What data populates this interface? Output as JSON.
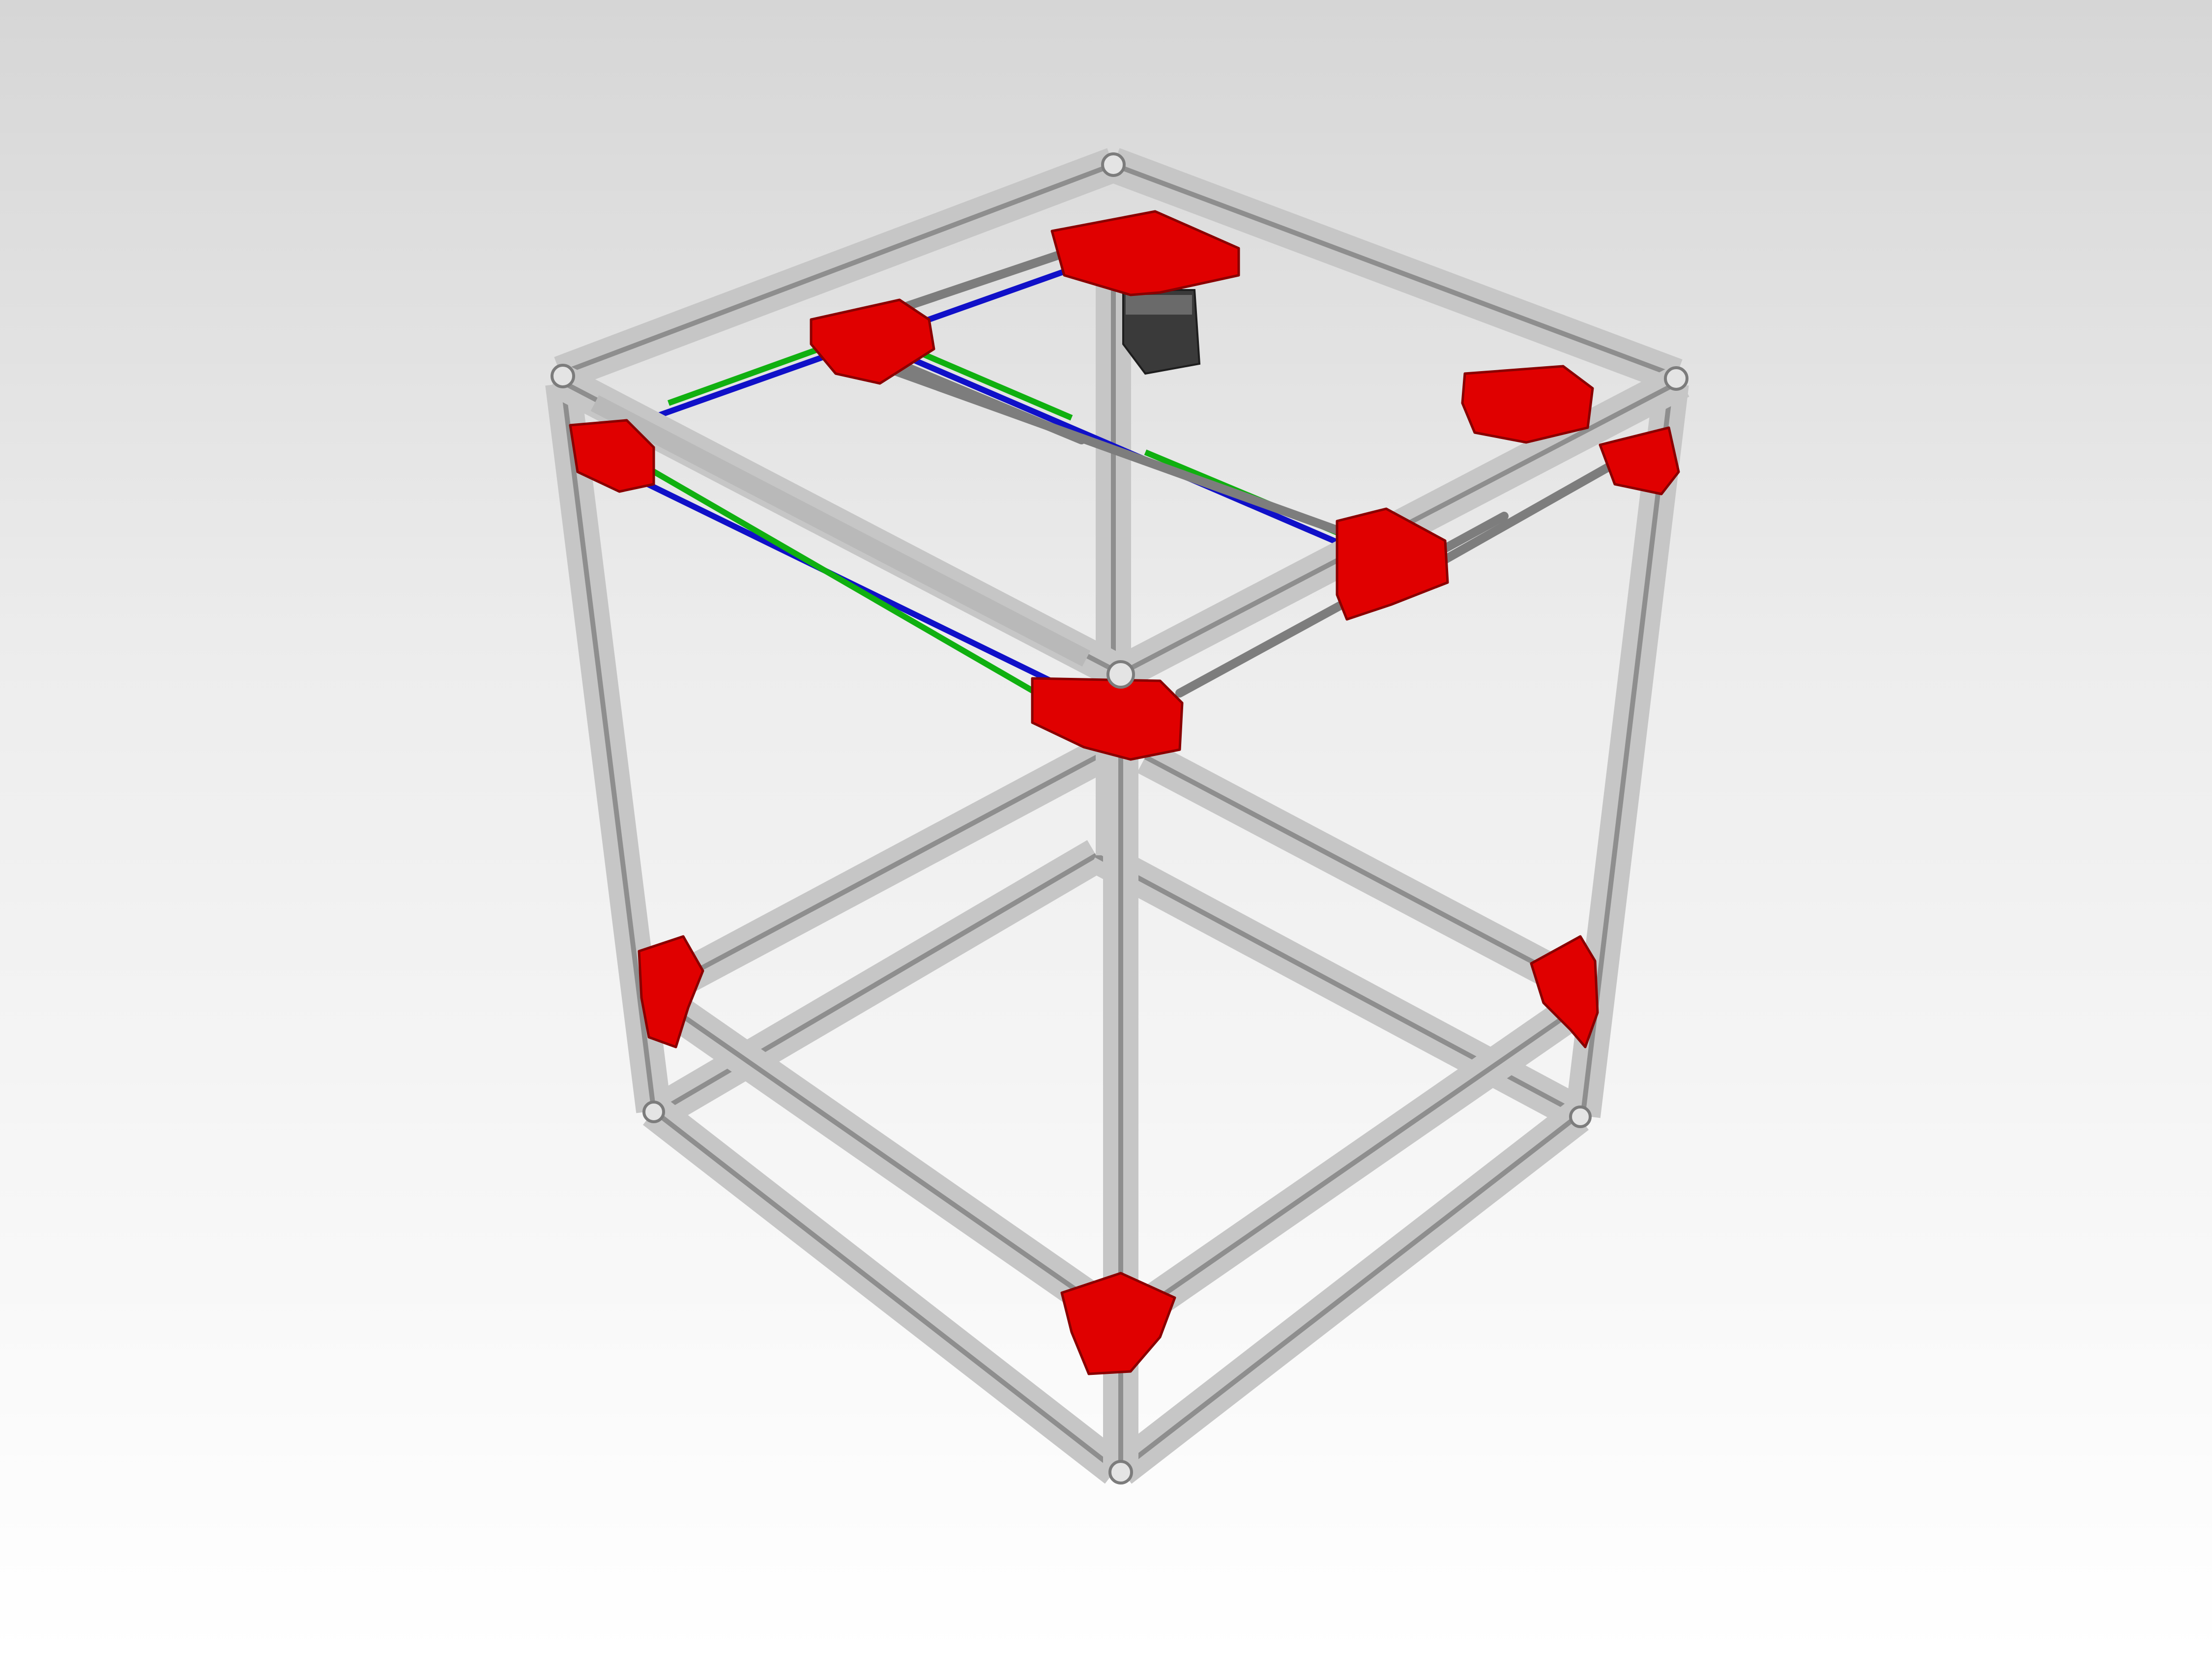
{
  "scene": {
    "subject": "corexy-printer-frame",
    "background_top": "#d6d6d6",
    "background_bottom": "#ffffff",
    "colors": {
      "extrusion": "#c6c6c6",
      "extrusion_edge": "#8e8e8e",
      "bracket": "#e00000",
      "rod": "#7d7d7d",
      "belt_a": "#1010c8",
      "belt_b": "#10b010",
      "motor": "#3a3a3a"
    }
  }
}
